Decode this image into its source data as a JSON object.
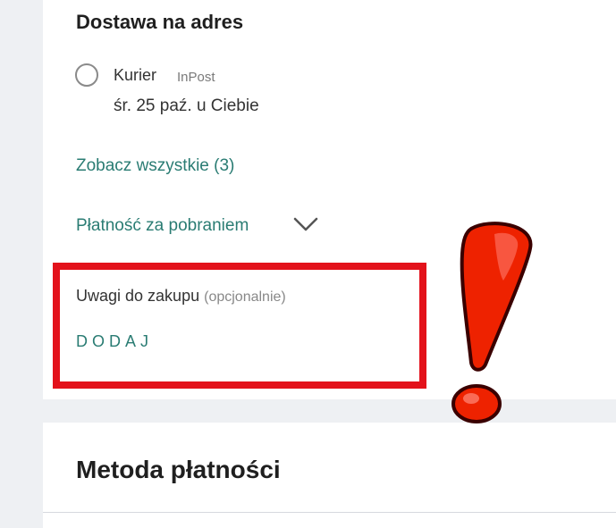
{
  "delivery": {
    "title": "Dostawa na adres",
    "option": {
      "name": "Kurier",
      "brand": "InPost",
      "date": "śr. 25 paź. u Ciebie"
    },
    "see_all_label": "Zobacz wszystkie (3)",
    "payment_option_label": "Płatność za pobraniem"
  },
  "notes": {
    "label": "Uwagi do zakupu",
    "optional_label": "(opcjonalnie)",
    "add_label": "DODAJ"
  },
  "payment": {
    "title": "Metoda płatności"
  },
  "icons": {
    "radio": "radio-unchecked-icon",
    "chevron": "chevron-down-icon",
    "annotation": "exclamation-mark-icon"
  },
  "colors": {
    "link": "#2a7c73",
    "highlight": "#e3121b",
    "background": "#eef0f3"
  }
}
